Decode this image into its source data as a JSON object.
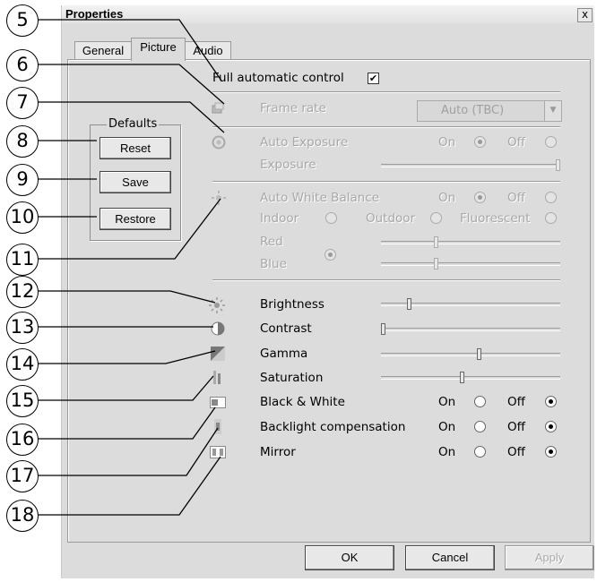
{
  "window": {
    "title": "Properties",
    "close_glyph": "x"
  },
  "tabs": [
    {
      "label": "General"
    },
    {
      "label": "Picture",
      "active": true
    },
    {
      "label": "Audio"
    }
  ],
  "full_auto": {
    "label": "Full automatic control",
    "checked": true,
    "check_glyph": "✔"
  },
  "frame_rate": {
    "label": "Frame rate",
    "value": "Auto (TBC)",
    "arrow": "▼"
  },
  "exposure": {
    "auto_label": "Auto Exposure",
    "on": "On",
    "off": "Off",
    "exposure_label": "Exposure",
    "exposure_level": 1.0
  },
  "white_balance": {
    "auto_label": "Auto White Balance",
    "on": "On",
    "off": "Off",
    "indoor": "Indoor",
    "outdoor": "Outdoor",
    "fluorescent": "Fluorescent",
    "red_label": "Red",
    "blue_label": "Blue",
    "red_level": 0.3,
    "blue_level": 0.3
  },
  "defaults": {
    "legend": "Defaults",
    "reset": "Reset",
    "save": "Save",
    "restore": "Restore"
  },
  "adjust": {
    "brightness": "Brightness",
    "contrast": "Contrast",
    "gamma": "Gamma",
    "saturation": "Saturation",
    "brightness_level": 0.15,
    "contrast_level": 0.0,
    "gamma_level": 0.55,
    "saturation_level": 0.45
  },
  "toggles": {
    "bw": "Black & White",
    "backlight": "Backlight compensation",
    "mirror": "Mirror",
    "on": "On",
    "off": "Off"
  },
  "footer": {
    "ok": "OK",
    "cancel": "Cancel",
    "apply": "Apply"
  },
  "callouts": [
    "5",
    "6",
    "7",
    "8",
    "9",
    "10",
    "11",
    "12",
    "13",
    "14",
    "15",
    "16",
    "17",
    "18"
  ],
  "icons": [
    "frame-rate-icon",
    "exposure-icon",
    "white-balance-icon",
    "brightness-icon",
    "contrast-icon",
    "gamma-icon",
    "saturation-icon",
    "black-white-icon",
    "backlight-icon",
    "mirror-icon"
  ]
}
